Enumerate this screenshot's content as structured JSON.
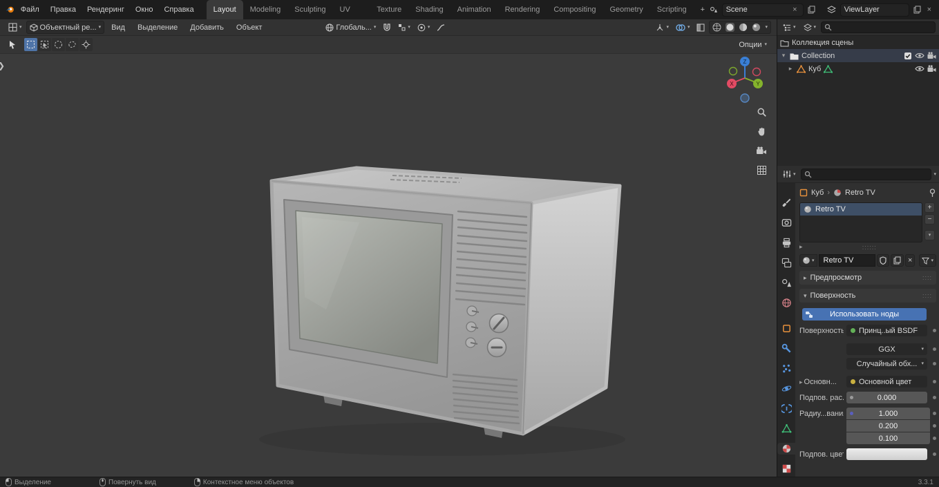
{
  "colors": {
    "accent_blue": "#4772b3",
    "object_orange": "#e8913c",
    "mesh_green": "#3fbf78",
    "axis_x_red": "#e24b64",
    "axis_y_green": "#84b32c",
    "axis_z_blue": "#3a7fd5"
  },
  "topbar": {
    "menus": [
      "Файл",
      "Правка",
      "Рендеринг",
      "Окно",
      "Справка"
    ],
    "tabs": [
      "Layout",
      "Modeling",
      "Sculpting",
      "UV Editing",
      "Texture Paint",
      "Shading",
      "Animation",
      "Rendering",
      "Compositing",
      "Geometry Nodes",
      "Scripting"
    ],
    "add_tab": "+",
    "scene_label": "Scene",
    "viewlayer_label": "ViewLayer",
    "unlink": "×"
  },
  "viewport": {
    "header": {
      "mode": "Объектный ре...",
      "menus": [
        "Вид",
        "Выделение",
        "Добавить",
        "Объект"
      ],
      "orientation": "Глобаль..."
    },
    "tool_header": {
      "options": "Опции"
    },
    "gizmo": {
      "x": "X",
      "y": "Y",
      "z": "Z"
    }
  },
  "outliner": {
    "rows": [
      {
        "label": "Коллекция сцены"
      },
      {
        "label": "Collection"
      },
      {
        "label": "Куб"
      }
    ]
  },
  "properties": {
    "breadcrumb": {
      "object": "Куб",
      "separator": "›",
      "material": "Retro TV"
    },
    "slots": {
      "active": "Retro TV"
    },
    "datablock": {
      "name": "Retro TV",
      "unlink": "×"
    },
    "panels": {
      "preview": "Предпросмотр",
      "surface": "Поверхность"
    },
    "surface": {
      "use_nodes": "Использовать ноды",
      "surface_label": "Поверхность",
      "surface_value": "Принц..ый BSDF",
      "distribution": "GGX",
      "subsurface_method": "Случайный обх...",
      "base_section_label": "Основн...",
      "base_color_value": "Основной цвет",
      "subsurface_label": "Подпов. рас...",
      "subsurface_value": "0.000",
      "radius_label": "Радиу...вания",
      "radius_x": "1.000",
      "radius_y": "0.200",
      "radius_z": "0.100",
      "subsurface_color_label": "Подпов. цвет"
    }
  },
  "statusbar": {
    "select": "Выделение",
    "rotate": "Повернуть вид",
    "context_menu": "Контекстное меню объектов",
    "version": "3.3.1"
  }
}
